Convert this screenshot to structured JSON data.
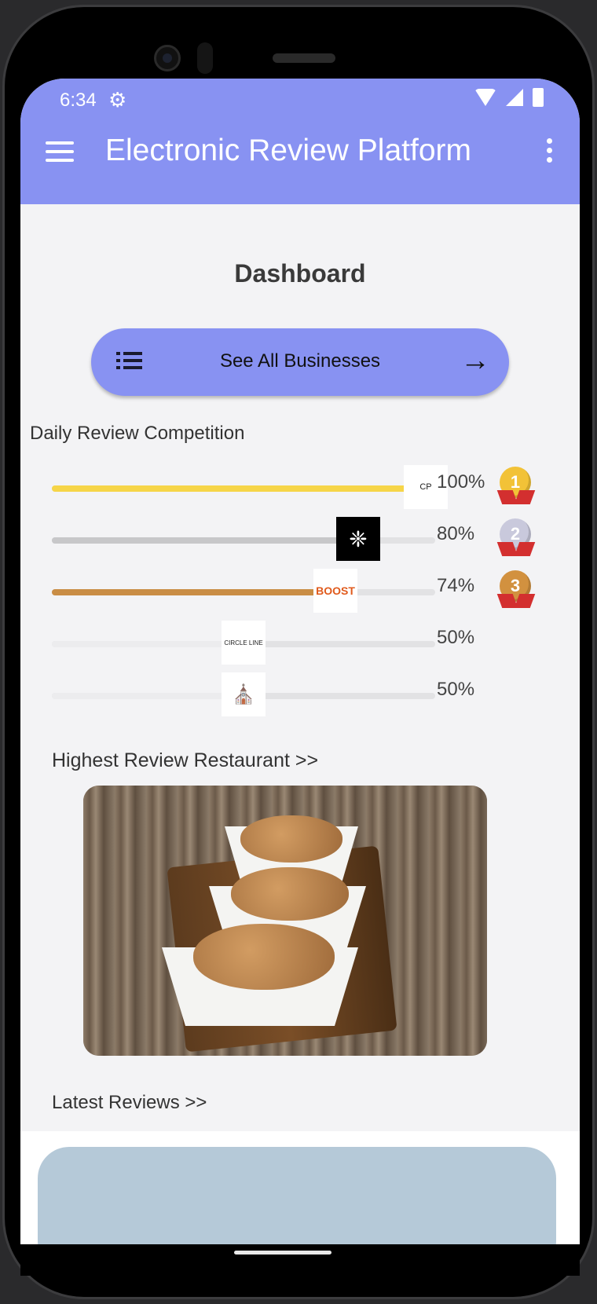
{
  "status_bar": {
    "time": "6:34"
  },
  "app_bar": {
    "title": "Electronic Review Platform"
  },
  "dashboard": {
    "title": "Dashboard",
    "see_all_button": "See All Businesses"
  },
  "competition": {
    "label": "Daily Review Competition",
    "rows": [
      {
        "percent": "100%",
        "fill_fraction": 1.0,
        "fill_color": "#f6d548",
        "medal": "1",
        "medal_color": "#f2c237",
        "logo_text": "CP"
      },
      {
        "percent": "80%",
        "fill_fraction": 0.8,
        "fill_color": "#c7c7c9",
        "medal": "2",
        "medal_color": "#c9c9dc",
        "logo_text": "❈"
      },
      {
        "percent": "74%",
        "fill_fraction": 0.74,
        "fill_color": "#c98d45",
        "medal": "3",
        "medal_color": "#d2913f",
        "logo_text": "BOOST"
      },
      {
        "percent": "50%",
        "fill_fraction": 0.5,
        "fill_color": "#ececee",
        "medal": "",
        "medal_color": "",
        "logo_text": "CIRCLE LINE"
      },
      {
        "percent": "50%",
        "fill_fraction": 0.5,
        "fill_color": "#ececee",
        "medal": "",
        "medal_color": "",
        "logo_text": "⛪"
      }
    ]
  },
  "highest_review": {
    "label": "Highest Review Restaurant >>"
  },
  "latest_reviews": {
    "label": "Latest Reviews >>"
  }
}
